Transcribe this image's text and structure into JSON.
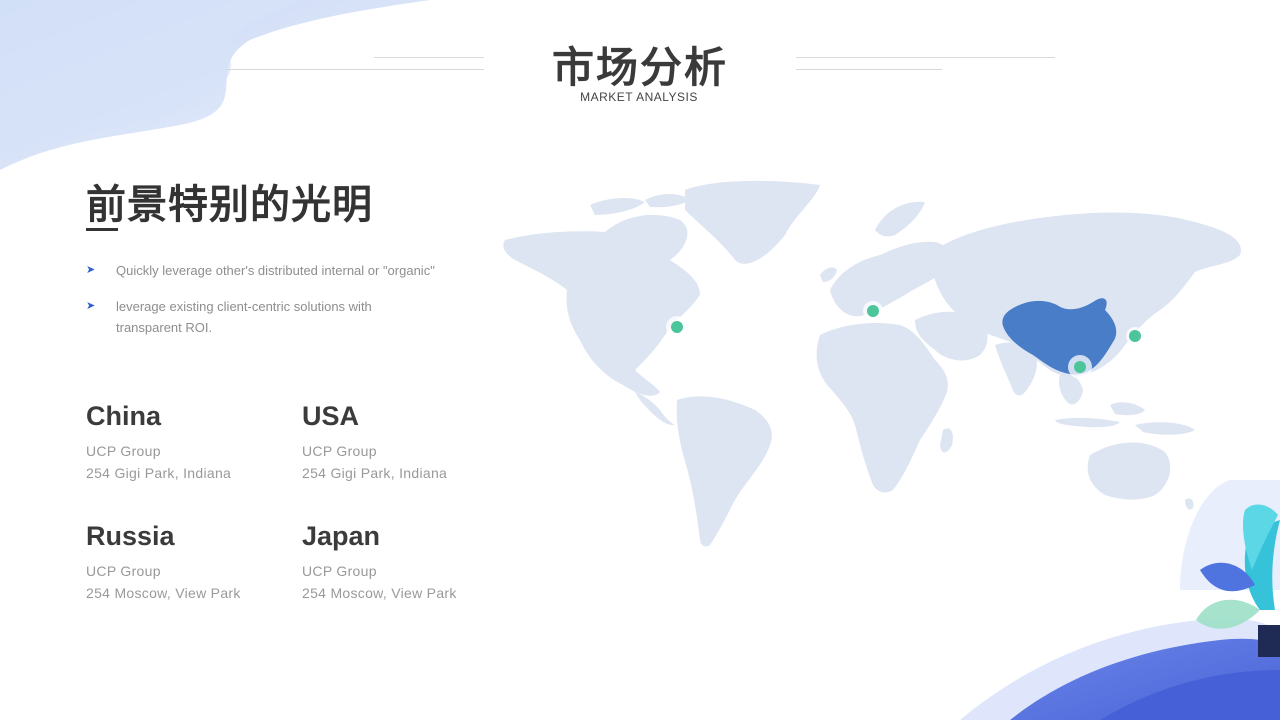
{
  "header": {
    "title": "市场分析",
    "subtitle": "MARKET ANALYSIS"
  },
  "section": {
    "heading": "前景特别的光明",
    "bullets": [
      "Quickly leverage other's distributed internal or \"organic\"",
      "leverage existing client-centric solutions with transparent ROI."
    ],
    "bullet_icon": "arrow-right-icon"
  },
  "countries": [
    {
      "name": "China",
      "company": "UCP Group",
      "address": "254 Gigi Park, Indiana"
    },
    {
      "name": "USA",
      "company": "UCP Group",
      "address": "254 Gigi Park, Indiana"
    },
    {
      "name": "Russia",
      "company": "UCP Group",
      "address": "254 Moscow, View Park"
    },
    {
      "name": "Japan",
      "company": "UCP Group",
      "address": "254 Moscow, View Park"
    }
  ],
  "map": {
    "highlighted_country": "China",
    "land_color": "#dde5f2",
    "highlight_color": "#4a7dc8",
    "marker_color": "#4cc59a"
  },
  "colors": {
    "accent_blue": "#4f6fe0",
    "text_dark": "#333333",
    "text_muted": "#999999"
  }
}
